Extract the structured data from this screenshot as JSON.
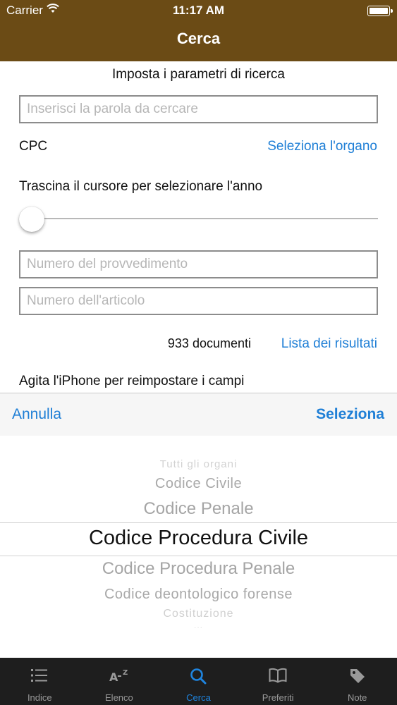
{
  "status_bar": {
    "carrier": "Carrier",
    "time": "11:17 AM"
  },
  "nav": {
    "title": "Cerca"
  },
  "form": {
    "subtitle": "Imposta i parametri di ricerca",
    "search_placeholder": "Inserisci la parola da cercare",
    "organ_value": "CPC",
    "select_organ_link": "Seleziona l'organo",
    "slider_label": "Trascina il cursore per selezionare l'anno",
    "slider_value": 0,
    "numero_placeholder": "Numero del provvedimento",
    "articolo_placeholder": "Numero dell'articolo",
    "documents_count": "933 documenti",
    "results_link": "Lista dei risultati",
    "shake_hint": "Agita l'iPhone per reimpostare i campi"
  },
  "picker_toolbar": {
    "cancel": "Annulla",
    "select": "Seleziona"
  },
  "picker": {
    "options": [
      "Tutti gli organi",
      "Codice Civile",
      "Codice Penale",
      "Codice Procedura Civile",
      "Codice Procedura Penale",
      "Codice deontologico forense",
      "Costituzione",
      "..."
    ],
    "selected": "Codice Procedura Civile"
  },
  "tabs": [
    {
      "label": "Indice",
      "icon": "list-icon",
      "active": false
    },
    {
      "label": "Elenco",
      "icon": "az-sort-icon",
      "active": false
    },
    {
      "label": "Cerca",
      "icon": "search-icon",
      "active": true
    },
    {
      "label": "Preferiti",
      "icon": "book-icon",
      "active": false
    },
    {
      "label": "Note",
      "icon": "tag-icon",
      "active": false
    }
  ],
  "colors": {
    "navbar": "#6b4b15",
    "accent": "#1f7fd6",
    "tabbar": "#1e1e1e",
    "tab_active": "#1f85e0"
  }
}
